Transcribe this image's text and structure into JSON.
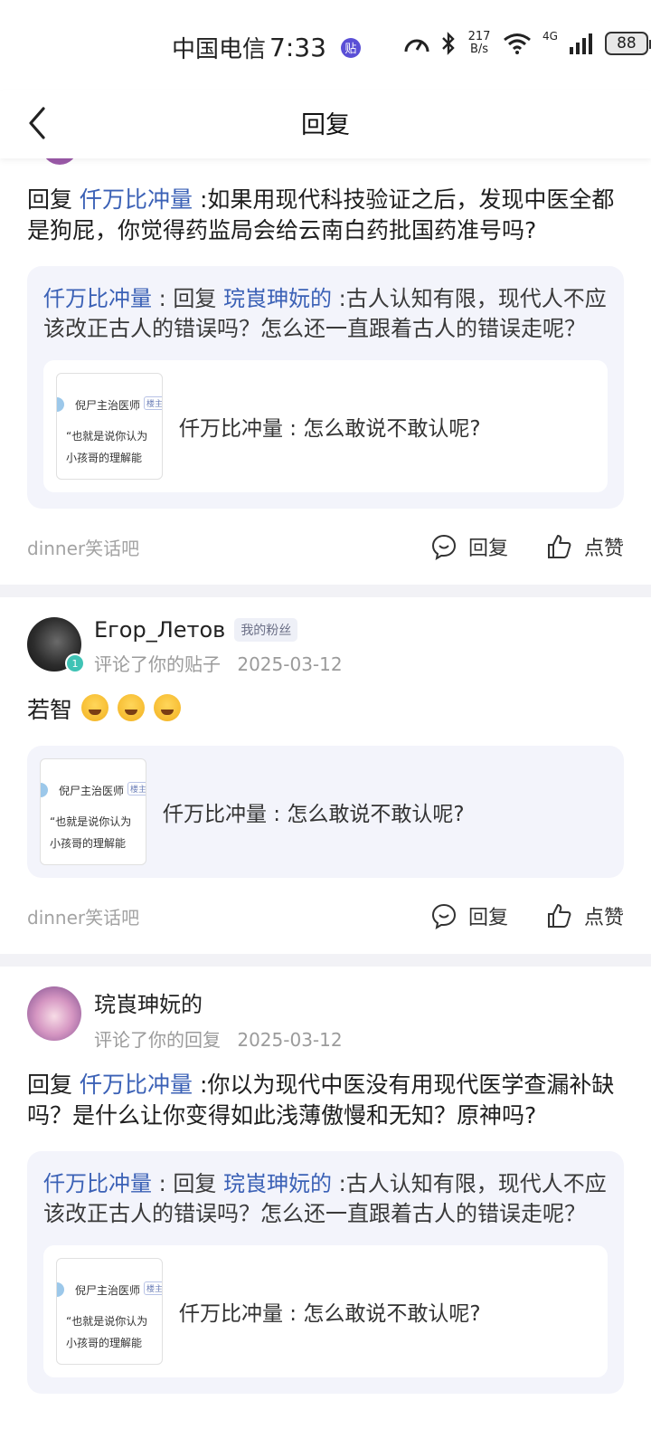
{
  "status_bar": {
    "carrier": "中国电信",
    "time": "7:33",
    "app_badge": "贴",
    "net_speed_value": "217",
    "net_speed_unit": "B/s",
    "network": "4G",
    "battery": "88"
  },
  "header": {
    "back_icon": "chevron-left-icon",
    "title": "回复"
  },
  "cards": [
    {
      "comment_prefix": "回复",
      "comment_mention": "仟万比冲量",
      "comment_text": ":如果用现代科技验证之后，发现中医全都是狗屁，你觉得药监局会给云南白药批国药准号吗?",
      "quote_author": "仟万比冲量",
      "quote_mid": ": 回复",
      "quote_mention": "琓崀珅妧的",
      "quote_text": ":古人认知有限，现代人不应该改正古人的错误吗？怎么还一直跟着古人的错误走呢？",
      "post_thumb": {
        "name": "倪尸主治医师",
        "tag": "楼主",
        "line1": "“也就是说你认为",
        "line2": "小孩哥的理解能"
      },
      "post_title": "仟万比冲量 : 怎么敢说不敢认呢?",
      "forum": "dinner笑话吧",
      "reply_label": "回复",
      "like_label": "点赞"
    },
    {
      "username": "Егор_Летов",
      "fan_tag": "我的粉丝",
      "level": "1",
      "action": "评论了你的贴子",
      "date": "2025-03-12",
      "comment_text": "若智",
      "emoji_icons": [
        "sweat-grin-emoji",
        "sweat-grin-emoji",
        "sweat-grin-emoji"
      ],
      "post_thumb": {
        "name": "倪尸主治医师",
        "tag": "楼主",
        "line1": "“也就是说你认为",
        "line2": "小孩哥的理解能"
      },
      "post_title": "仟万比冲量 : 怎么敢说不敢认呢?",
      "forum": "dinner笑话吧",
      "reply_label": "回复",
      "like_label": "点赞"
    },
    {
      "username": "琓崀珅妧的",
      "action": "评论了你的回复",
      "date": "2025-03-12",
      "comment_prefix": "回复",
      "comment_mention": "仟万比冲量",
      "comment_text": ":你以为现代中医没有用现代医学查漏补缺吗？是什么让你变得如此浅薄傲慢和无知？原神吗?",
      "quote_author": "仟万比冲量",
      "quote_mid": ": 回复",
      "quote_mention": "琓崀珅妧的",
      "quote_text": ":古人认知有限，现代人不应该改正古人的错误吗？怎么还一直跟着古人的错误走呢？",
      "post_thumb": {
        "name": "倪尸主治医师",
        "tag": "楼主",
        "line1": "“也就是说你认为",
        "line2": "小孩哥的理解能"
      },
      "post_title": "仟万比冲量 : 怎么敢说不敢认呢?"
    }
  ],
  "colors": {
    "mention": "#3b61b6",
    "quote_bg": "#f3f4fb",
    "muted": "#9b9b9b"
  }
}
